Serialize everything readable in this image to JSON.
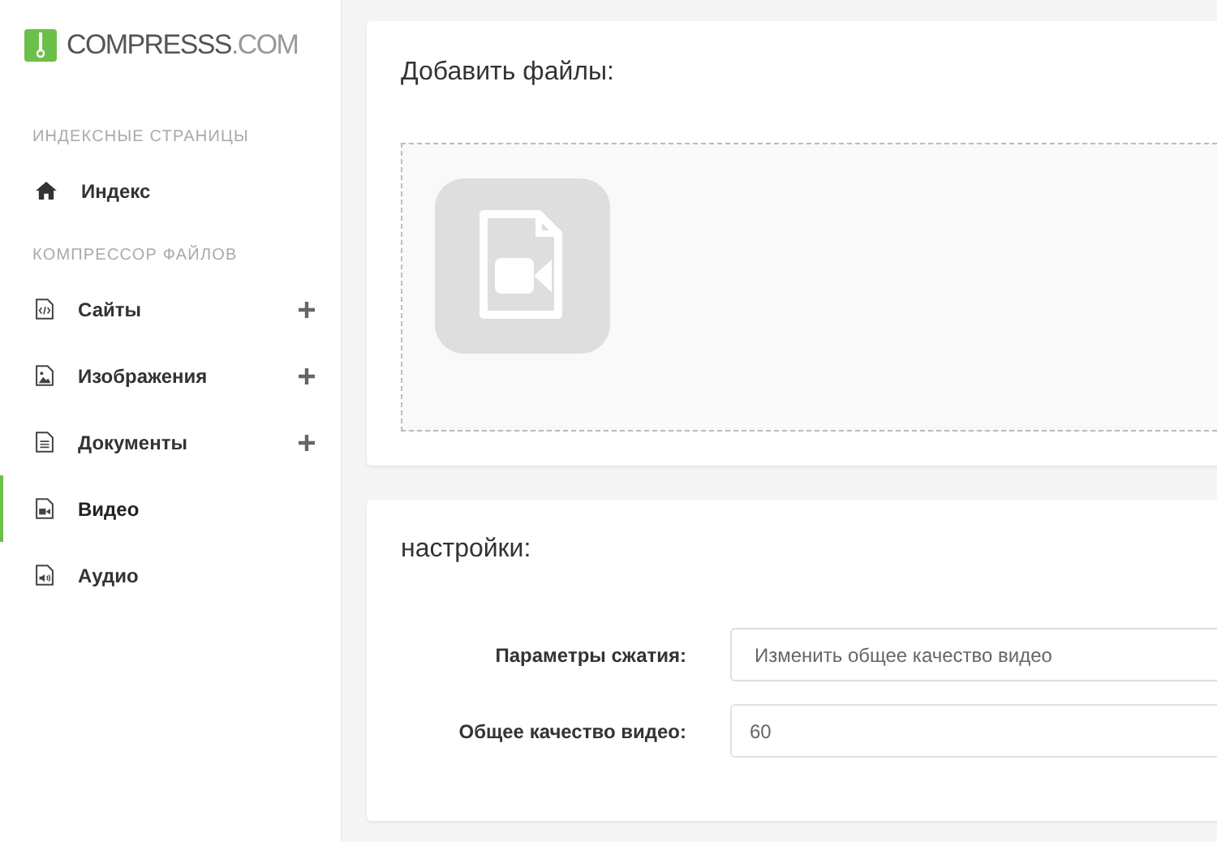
{
  "logo": {
    "name": "COMPRESSS",
    "suffix": ".COM"
  },
  "sidebar": {
    "sections": [
      {
        "heading": "ИНДЕКСНЫЕ СТРАНИЦЫ",
        "items": [
          {
            "kind": "home",
            "label": "Индекс",
            "expandable": false,
            "selected": false
          }
        ]
      },
      {
        "heading": "КОМПРЕССОР ФАЙЛОВ",
        "items": [
          {
            "kind": "code",
            "label": "Сайты",
            "expandable": true,
            "selected": false
          },
          {
            "kind": "image",
            "label": "Изображения",
            "expandable": true,
            "selected": false
          },
          {
            "kind": "document",
            "label": "Документы",
            "expandable": true,
            "selected": false
          },
          {
            "kind": "video",
            "label": "Видео",
            "expandable": false,
            "selected": true
          },
          {
            "kind": "audio",
            "label": "Аудио",
            "expandable": false,
            "selected": false
          }
        ]
      }
    ]
  },
  "upload": {
    "title": "Добавить файлы:"
  },
  "settings": {
    "title": "настройки:",
    "fields": [
      {
        "kind": "select",
        "label": "Параметры сжатия:",
        "value": "Изменить общее качество видео"
      },
      {
        "kind": "input",
        "label": "Общее качество видео:",
        "value": "60"
      }
    ]
  }
}
